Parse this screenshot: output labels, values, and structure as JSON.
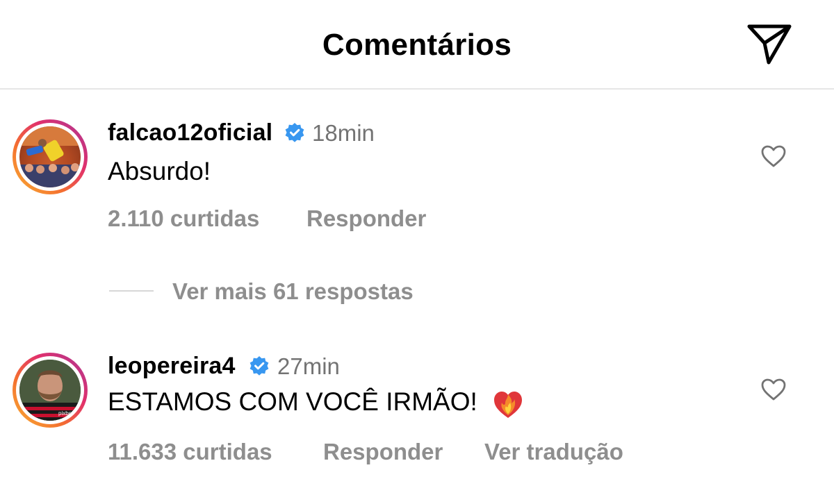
{
  "header": {
    "title": "Comentários",
    "send_icon": "paper-plane-icon"
  },
  "comments": [
    {
      "username": "falcao12oficial",
      "verified": true,
      "time": "18min",
      "text": "Absurdo!",
      "emoji": "",
      "likes": "2.110 curtidas",
      "reply_label": "Responder",
      "translate_label": "",
      "replies_label": "Ver mais 61 respostas"
    },
    {
      "username": "leopereira4",
      "verified": true,
      "time": "27min",
      "text": "ESTAMOS COM VOCÊ IRMÃO!",
      "emoji": "heart-on-fire-emoji",
      "likes": "11.633 curtidas",
      "reply_label": "Responder",
      "translate_label": "Ver tradução"
    }
  ],
  "colors": {
    "verified": "#3897f0",
    "muted": "#8e8e8e",
    "time": "#737373"
  }
}
